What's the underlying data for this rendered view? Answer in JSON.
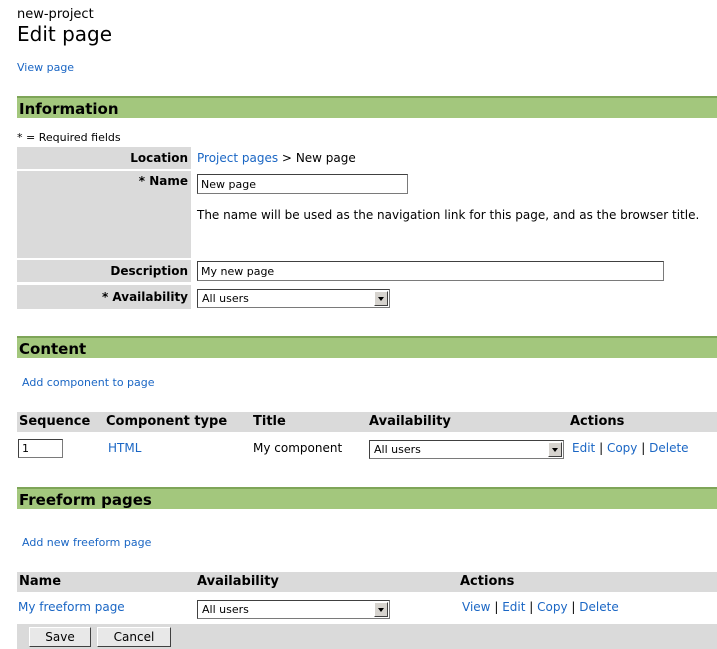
{
  "header": {
    "project": "new-project",
    "title": "Edit page",
    "view_page_link": "View page"
  },
  "information": {
    "heading": "Information",
    "required_note": "* = Required fields",
    "location_label": "Location",
    "location_link": "Project pages",
    "location_sep": ">",
    "location_current": "New page",
    "name_label": "* Name",
    "name_value": "New page",
    "name_help": "The name will be used as the navigation link for this page, and as the browser title.",
    "description_label": "Description",
    "description_value": "My new page",
    "availability_label": "* Availability",
    "availability_value": "All users"
  },
  "content": {
    "heading": "Content",
    "add_link": "Add component to page",
    "columns": [
      "Sequence",
      "Component type",
      "Title",
      "Availability",
      "Actions"
    ],
    "rows": [
      {
        "sequence": "1",
        "type": "HTML",
        "title": "My component",
        "availability": "All users",
        "actions": [
          "Edit",
          "Copy",
          "Delete"
        ]
      }
    ]
  },
  "freeform": {
    "heading": "Freeform pages",
    "add_link": "Add new freeform page",
    "columns": [
      "Name",
      "Availability",
      "Actions"
    ],
    "rows": [
      {
        "name": "My freeform page",
        "availability": "All users",
        "actions": [
          "View",
          "Edit",
          "Copy",
          "Delete"
        ]
      }
    ]
  },
  "buttons": {
    "save": "Save",
    "cancel": "Cancel"
  },
  "separator": "|",
  "colors": {
    "section_bar": "#a3c77d",
    "label_bg": "#dadada",
    "link": "#1a66c4"
  }
}
